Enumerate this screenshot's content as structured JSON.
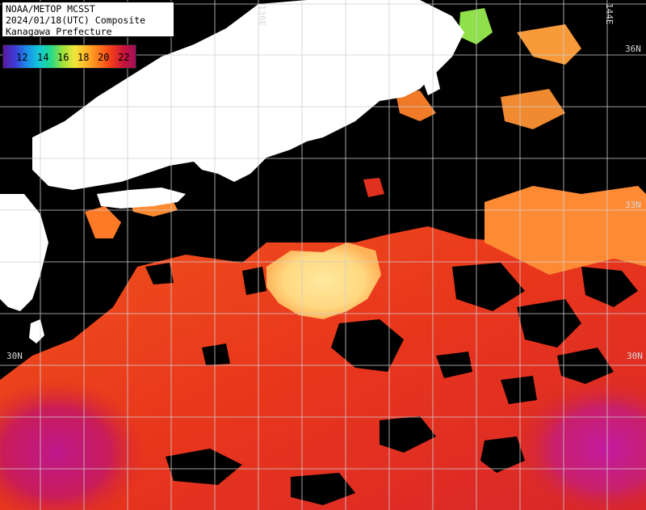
{
  "title": {
    "line1": "NOAA/METOP MCSST",
    "line2": "2024/01/18(UTC) Composite",
    "line3": "Kanagawa Prefecture"
  },
  "colorbar": {
    "ticks": [
      "12",
      "14",
      "16",
      "18",
      "20",
      "22"
    ]
  },
  "grid_labels": {
    "lon_136": "136E",
    "lon_144": "144E",
    "lat_36": "36N",
    "lat_33": "33N",
    "lat_30_left": "30N",
    "lat_30_right": "30N"
  },
  "colors": {
    "land": "#ffffff",
    "no_data": "#000000",
    "grid": "#cfcfcf",
    "sst_warm": "#e8361c",
    "sst_hot": "#c0186e",
    "sst_mid": "#ff8a2a",
    "sst_cool": "#ffd27a"
  }
}
